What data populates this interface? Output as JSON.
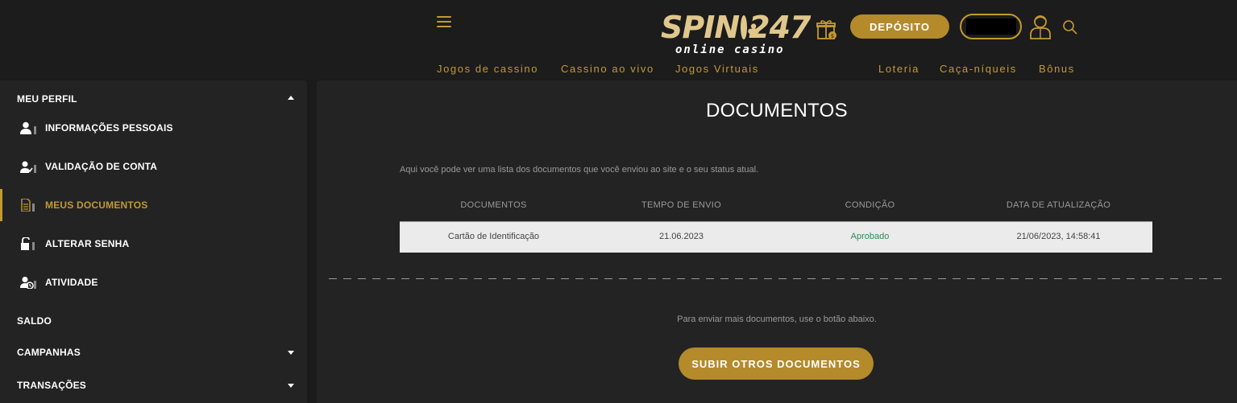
{
  "header": {
    "logo_main_left": "SPIN",
    "logo_main_right": "247",
    "logo_sub": "online casino",
    "deposit_label": "DEPÓSITO",
    "accent_color": "#c49a2f"
  },
  "topnav": [
    {
      "label": "Jogos de cassino"
    },
    {
      "label": "Cassino ao vivo"
    },
    {
      "label": "Jogos Virtuais"
    },
    {
      "label": "Loteria"
    },
    {
      "label": "Caça-níqueis"
    },
    {
      "label": "Bônus"
    }
  ],
  "sidebar": {
    "profile_section": "MEU PERFIL",
    "items": [
      {
        "label": "INFORMAÇÕES PESSOAIS",
        "icon": "user-icon"
      },
      {
        "label": "VALIDAÇÃO DE CONTA",
        "icon": "user-check-icon"
      },
      {
        "label": "MEUS DOCUMENTOS",
        "icon": "document-icon",
        "active": true
      },
      {
        "label": "ALTERAR SENHA",
        "icon": "unlock-icon"
      },
      {
        "label": "ATIVIDADE",
        "icon": "user-clock-icon"
      }
    ],
    "saldo": "SALDO",
    "campanhas": "CAMPANHAS",
    "transacoes": "TRANSAÇÕES"
  },
  "main": {
    "title": "DOCUMENTOS",
    "intro": "Aqui você pode ver uma lista dos documentos que você enviou ao site e o seu status atual.",
    "table": {
      "headers": [
        "DOCUMENTOS",
        "TEMPO DE ENVIO",
        "CONDIÇÃO",
        "DATA DE ATUALIZAÇÃO"
      ],
      "rows": [
        [
          "Cartão de Identificação",
          "21.06.2023",
          "Aprobado",
          "21/06/2023, 14:58:41"
        ]
      ]
    },
    "upload_hint": "Para enviar mais documentos, use o botão abaixo.",
    "upload_button": "SUBIR OTROS DOCUMENTOS"
  }
}
